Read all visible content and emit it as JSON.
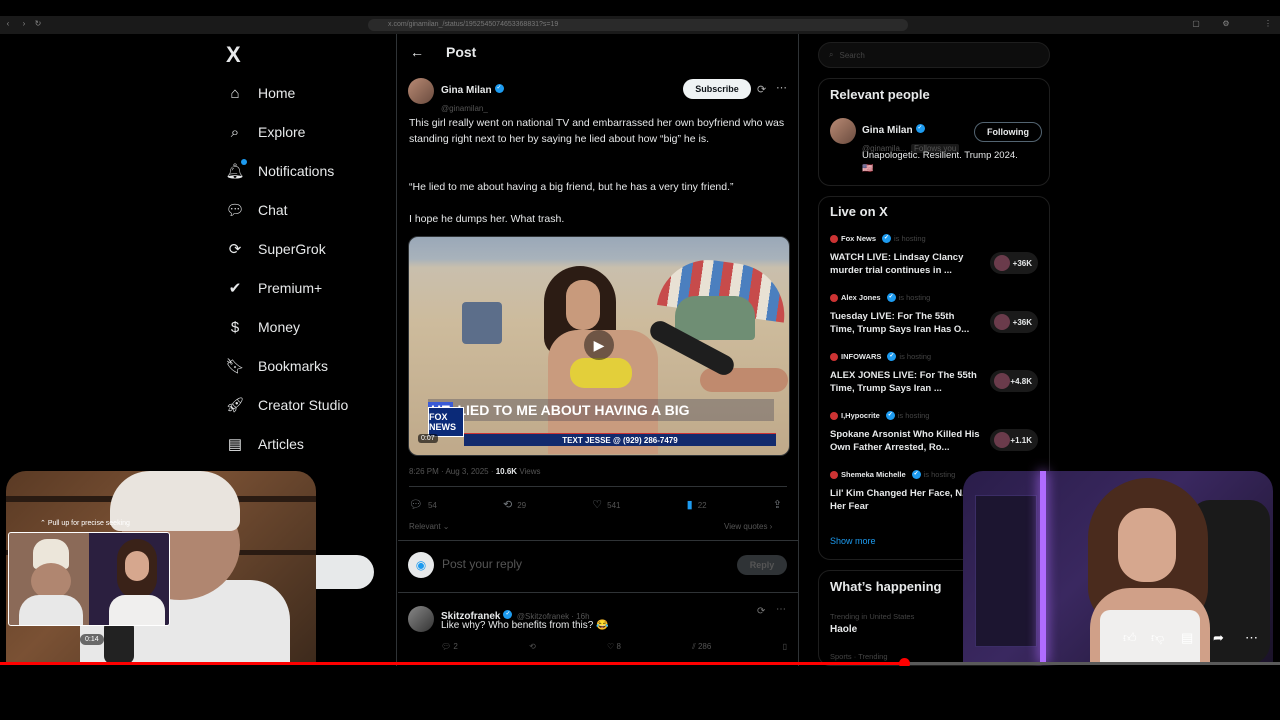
{
  "browser": {
    "url": "x.com/ginamilan_/status/1952545074653368831?s=19"
  },
  "nav": {
    "logo": "X",
    "items": [
      {
        "label": "Home",
        "icon": "home-icon"
      },
      {
        "label": "Explore",
        "icon": "search-icon"
      },
      {
        "label": "Notifications",
        "icon": "bell-icon"
      },
      {
        "label": "Chat",
        "icon": "chat-icon"
      },
      {
        "label": "SuperGrok",
        "icon": "grok-icon"
      },
      {
        "label": "Premium+",
        "icon": "premium-icon"
      },
      {
        "label": "Money",
        "icon": "dollar-icon"
      },
      {
        "label": "Bookmarks",
        "icon": "bookmark-icon"
      },
      {
        "label": "Creator Studio",
        "icon": "rocket-icon"
      },
      {
        "label": "Articles",
        "icon": "article-icon"
      }
    ]
  },
  "post": {
    "header_title": "Post",
    "author_name": "Gina Milan",
    "author_handle": "@ginamilan_",
    "subscribe_label": "Subscribe",
    "text_1": "This girl really went on national TV and embarrassed her own boyfriend who was standing right next to her by saying he lied about how “big” he is.",
    "text_2": "“He lied to me about having a big friend, but he has a very tiny friend.”",
    "text_3": "I hope he dumps her. What trash.",
    "video": {
      "chyron_highlight": "HE",
      "chyron_text": "LIED TO ME ABOUT HAVING A BIG",
      "network": "FOX NEWS",
      "ticker": "TEXT JESSE @ (929) 286-7479",
      "time": "0:07"
    },
    "timestamp": "8:26 PM · Aug 3, 2025",
    "views_count": "10.6K",
    "views_label": "Views",
    "stats": {
      "replies": "54",
      "reposts": "29",
      "likes": "541",
      "bookmarks": "22"
    },
    "relevant_label": "Relevant",
    "view_quotes": "View quotes",
    "reply_placeholder": "Post your reply",
    "reply_button": "Reply"
  },
  "reply": {
    "author_name": "Skitzofranek",
    "author_handle": "@Skitzofranek · 16h",
    "text": "Like why? Who benefits from this? 😂",
    "stats": {
      "replies": "2",
      "reposts": "",
      "likes": "8",
      "views": "286"
    }
  },
  "sidebar": {
    "search_placeholder": "Search",
    "relevant_title": "Relevant people",
    "person": {
      "name": "Gina Milan",
      "handle": "@ginamila...",
      "follows_you": "Follows you",
      "bio": "Unapologetic. Resilient. Trump 2024.",
      "button": "Following"
    },
    "live_title": "Live on X",
    "live": [
      {
        "host": "Fox News",
        "status": "is hosting",
        "title": "WATCH LIVE: Lindsay Clancy murder trial continues in ...",
        "count": "+36K"
      },
      {
        "host": "Alex Jones",
        "status": "is hosting",
        "title": "Tuesday LIVE: For The 55th Time, Trump Says Iran Has O...",
        "count": "+36K"
      },
      {
        "host": "INFOWARS",
        "status": "is hosting",
        "title": "ALEX JONES LIVE: For The 55th Time, Trump Says Iran ...",
        "count": "+4.8K"
      },
      {
        "host": "I,Hypocrite",
        "status": "is hosting",
        "title": "Spokane Arsonist Who Killed His Own Father Arrested, Ro...",
        "count": "+1.1K"
      },
      {
        "host": "Shemeka Michelle",
        "status": "is hosting",
        "title": "Lil' Kim Changed Her Face, N... Her Fear",
        "count": ""
      }
    ],
    "show_more": "Show more",
    "happening_title": "What’s happening",
    "trend_context": "Trending in United States",
    "trend_name": "Haole",
    "trend2_context": "Sports · Trending"
  },
  "overlay": {
    "pull_up_hint": "Pull up for precise seeking",
    "time": "0:14"
  },
  "colors": {
    "accent": "#1d9bf0",
    "progress": "#ff0000"
  }
}
